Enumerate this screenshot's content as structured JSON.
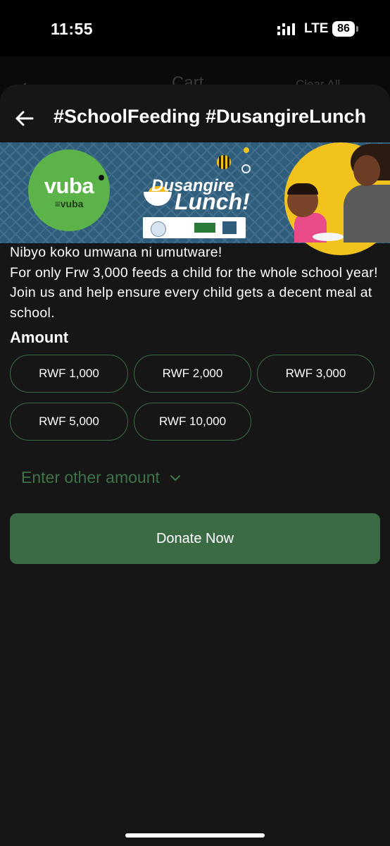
{
  "status_bar": {
    "time": "11:55",
    "network": "LTE",
    "battery": "86"
  },
  "background_screen": {
    "title": "Cart",
    "clear_label": "Clear All"
  },
  "header": {
    "title": "#SchoolFeeding #DusangireLunch"
  },
  "banner": {
    "brand_name": "vuba",
    "brand_sub": "≡vuba",
    "campaign_line1": "Dusangire",
    "campaign_line2": "Lunch!"
  },
  "description": {
    "line1": "Nibyo koko umwana ni umutware!",
    "line2": "For only Frw 3,000 feeds a child for the whole school year!  Join us and help ensure every child gets a decent meal at school."
  },
  "amount": {
    "label": "Amount",
    "options": [
      "RWF 1,000",
      "RWF 2,000",
      "RWF 3,000",
      "RWF 5,000",
      "RWF 10,000"
    ],
    "other_label": "Enter other amount"
  },
  "donate_button": {
    "label": "Donate Now"
  },
  "colors": {
    "accent": "#3a6b45",
    "sheet_bg": "#161616",
    "banner_bg": "#2f5d7c",
    "brand_green": "#5bb349",
    "banner_yellow": "#f2c21d"
  },
  "icons": [
    "back-arrow-icon",
    "chevron-down-icon",
    "signal-icon",
    "battery-icon"
  ]
}
